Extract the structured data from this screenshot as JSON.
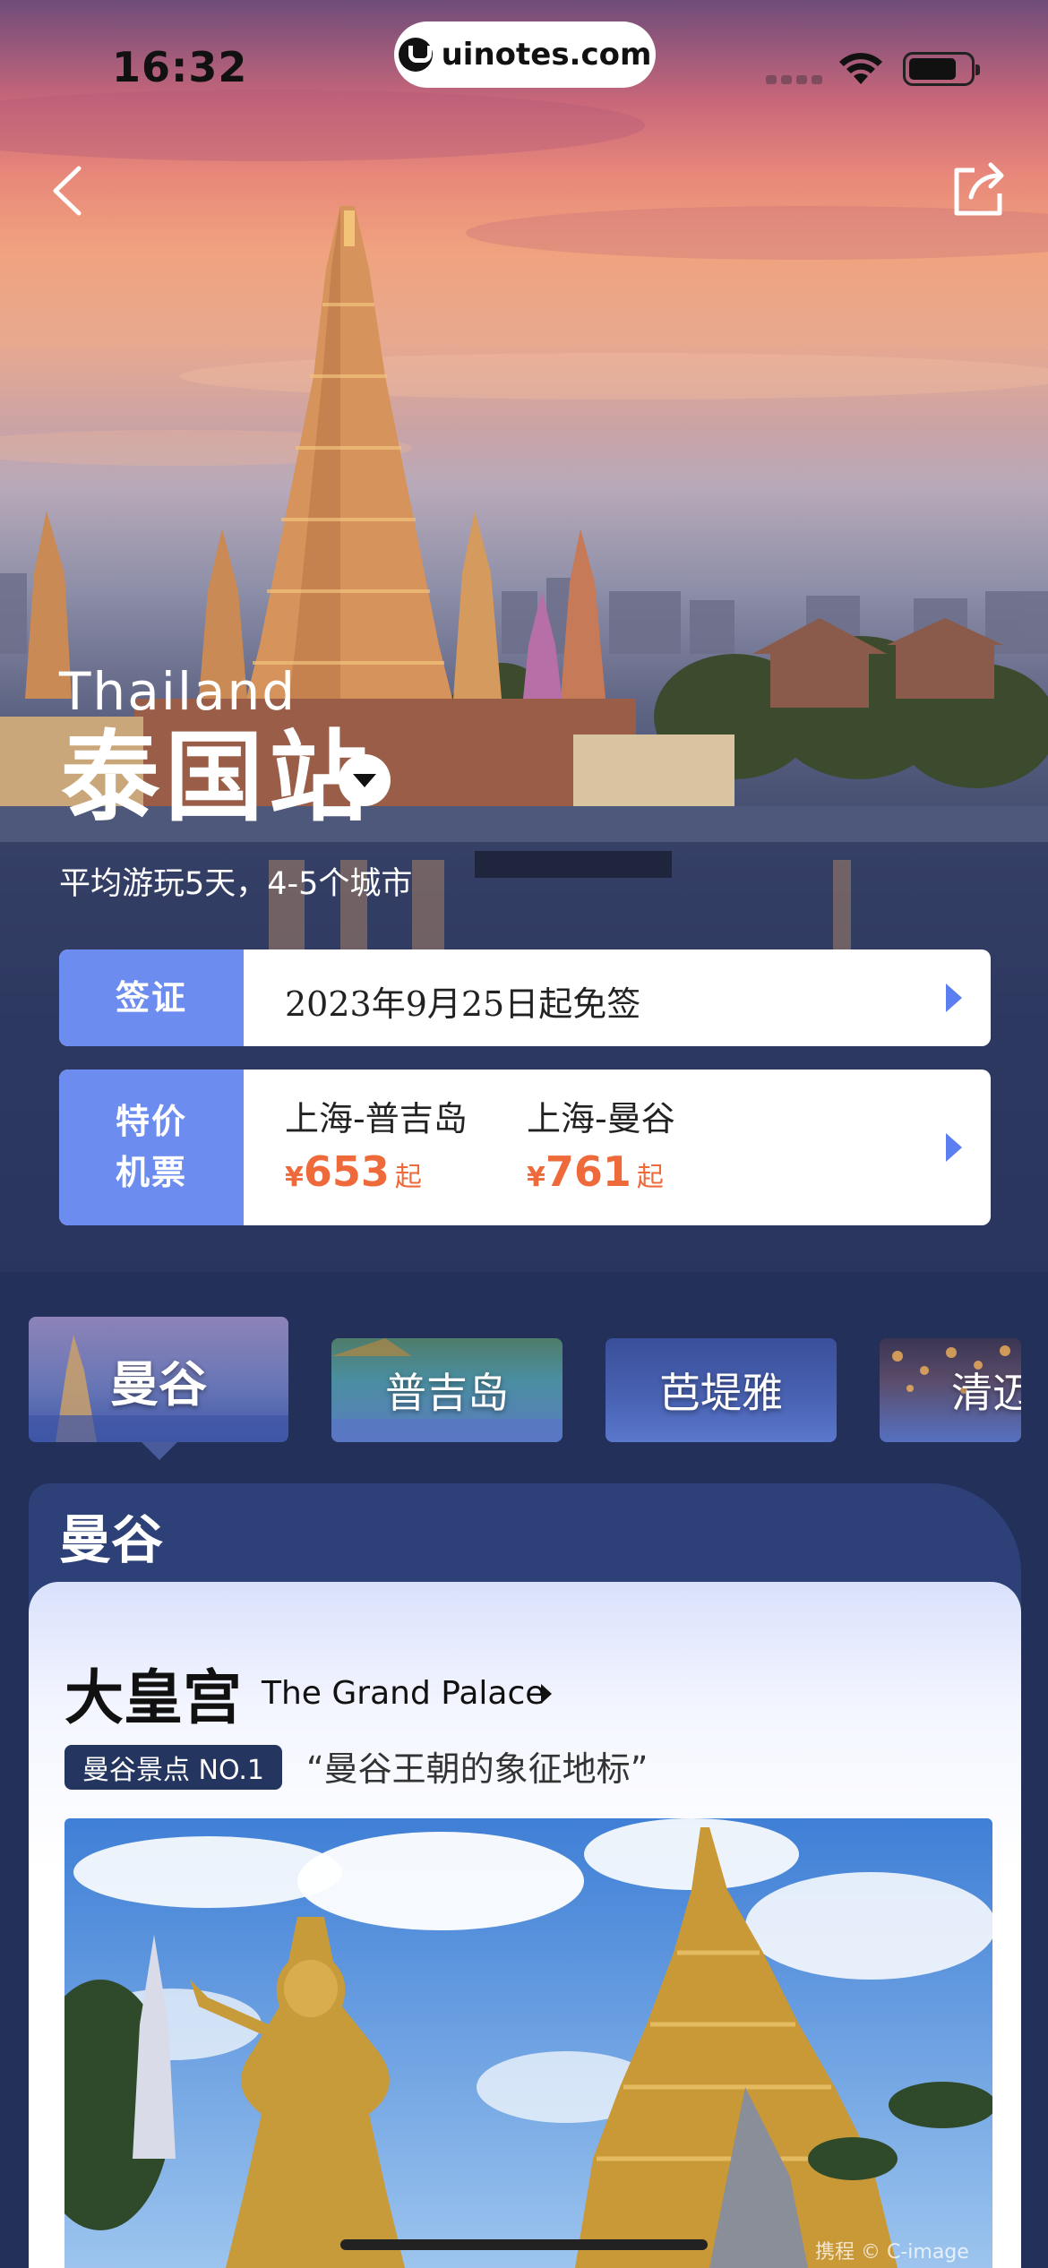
{
  "status_bar": {
    "time": "16:32",
    "url": "uinotes.com"
  },
  "nav": {
    "back_icon": "chevron-left-icon",
    "share_icon": "share-icon"
  },
  "hero": {
    "country_en": "Thailand",
    "country_cn": "泰国站",
    "summary": "平均游玩5天，4-5个城市"
  },
  "visa": {
    "label": "签证",
    "text": "2023年9月25日起免签"
  },
  "flights": {
    "label_line1": "特价",
    "label_line2": "机票",
    "routes": [
      {
        "name": "上海-普吉岛",
        "currency": "¥",
        "price": "653",
        "suffix": "起"
      },
      {
        "name": "上海-曼谷",
        "currency": "¥",
        "price": "761",
        "suffix": "起"
      }
    ]
  },
  "cities": [
    {
      "label": "曼谷",
      "active": true
    },
    {
      "label": "普吉岛",
      "active": false
    },
    {
      "label": "芭堤雅",
      "active": false
    },
    {
      "label": "清迈",
      "active": false
    }
  ],
  "section": {
    "title": "曼谷"
  },
  "attraction": {
    "name_cn": "大皇宫",
    "name_en": "The Grand Palace",
    "rank": "曼谷景点 NO.1",
    "quote": "“曼谷王朝的象征地标”",
    "watermark": "携程 © C-image"
  },
  "colors": {
    "accent": "#6d8cf0",
    "price": "#ef6a3a",
    "navy": "#23305a"
  }
}
